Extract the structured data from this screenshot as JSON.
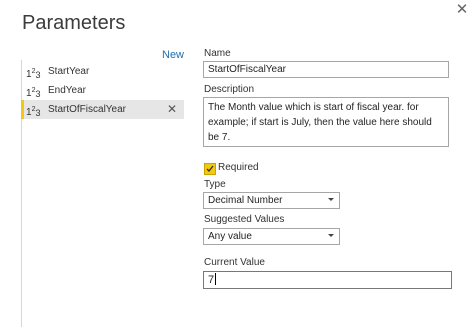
{
  "dialog": {
    "title": "Parameters",
    "close_glyph": "✕"
  },
  "list": {
    "new_label": "New",
    "items": [
      {
        "label": "StartYear",
        "icon": "number-type-icon",
        "selected": false
      },
      {
        "label": "EndYear",
        "icon": "number-type-icon",
        "selected": false
      },
      {
        "label": "StartOfFiscalYear",
        "icon": "number-type-icon",
        "selected": true
      }
    ],
    "delete_glyph": "✕"
  },
  "form": {
    "name_label": "Name",
    "name_value": "StartOfFiscalYear",
    "description_label": "Description",
    "description_value": "The Month value which is start of fiscal year. for example; if start is July, then the value here should be 7.",
    "required_label": "Required",
    "required_checked": true,
    "type_label": "Type",
    "type_value": "Decimal Number",
    "suggested_label": "Suggested Values",
    "suggested_value": "Any value",
    "current_label": "Current Value",
    "current_value": "7"
  },
  "colors": {
    "accent": "#f2c811",
    "link": "#1f6fb2",
    "selected_bg": "#e6e6e6"
  }
}
